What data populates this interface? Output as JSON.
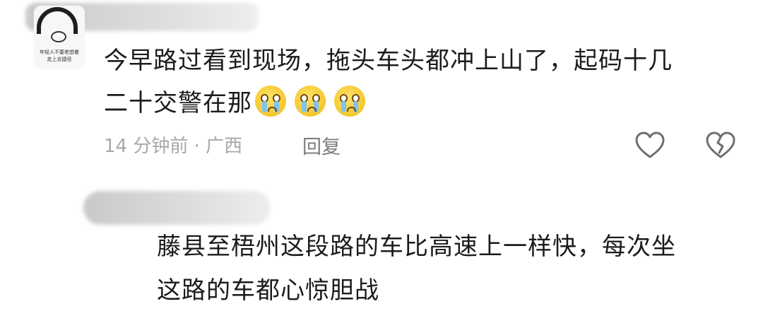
{
  "comment": {
    "avatar_text_line1": "年轻人不要老想着",
    "avatar_text_line2": "走上去捷径",
    "line1": "今早路过看到现场，拖头车头都冲上山了，起码十几",
    "line2": "二十交警在那",
    "emoji": "crying-face-emoji",
    "time": "14 分钟前",
    "separator": "·",
    "location": "广西",
    "reply_label": "回复",
    "like_icon": "heart-outline-icon",
    "dislike_icon": "broken-heart-icon"
  },
  "reply": {
    "line1": "藤县至梧州这段路的车比高速上一样快，每次坐",
    "line2": "这路的车都心惊胆战"
  },
  "colors": {
    "text": "#1b1b1b",
    "meta": "#a8a8a8",
    "icon": "#6f6f6f",
    "emoji": "#f5c62b"
  }
}
